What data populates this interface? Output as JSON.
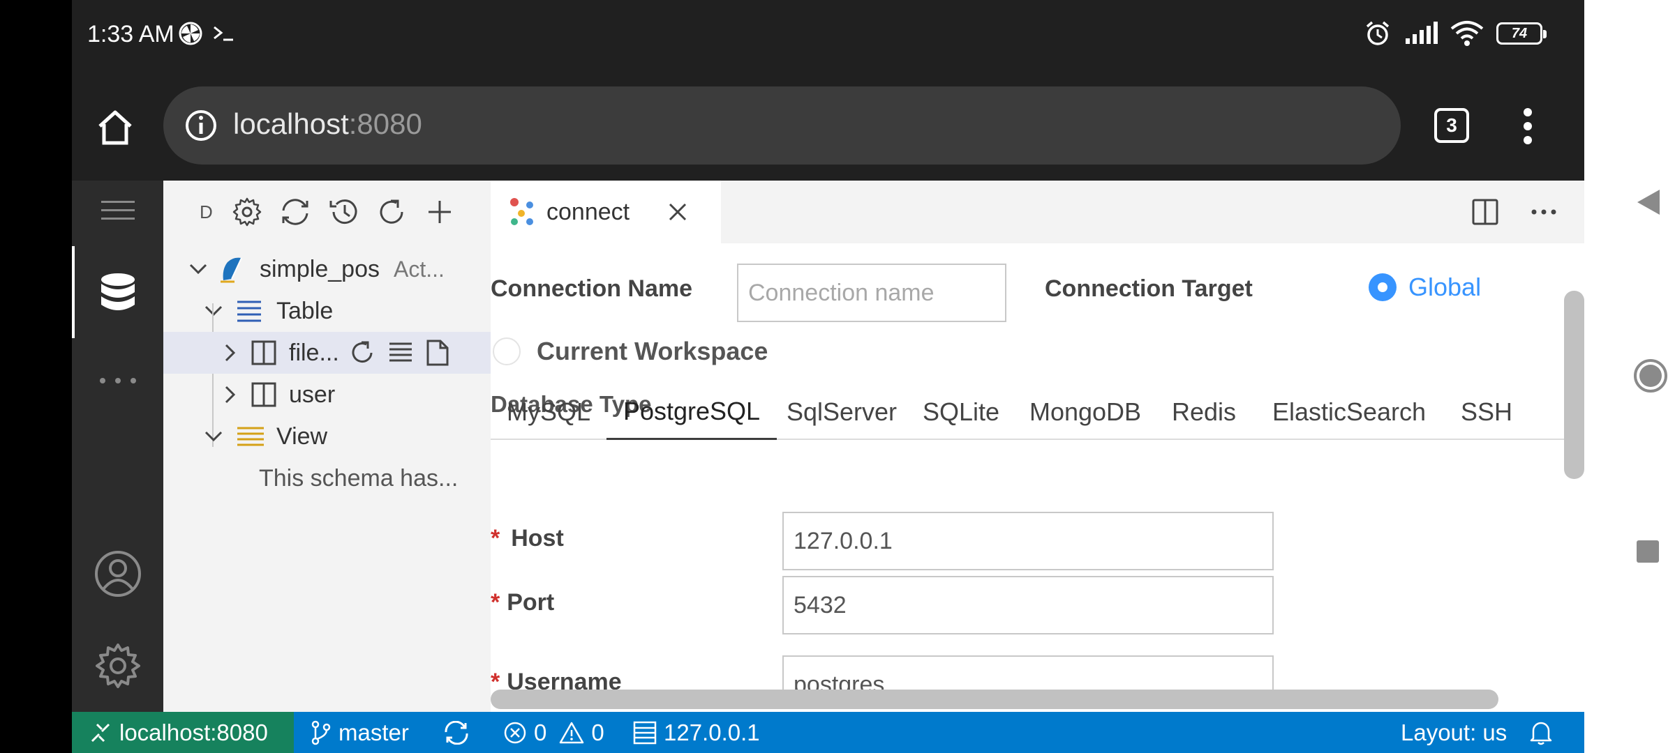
{
  "status_bar": {
    "time": "1:33 AM",
    "battery": "74",
    "icons": [
      "pinwheel-icon",
      "terminal-icon",
      "alarm-icon",
      "signal-icon",
      "wifi-icon",
      "battery-icon"
    ]
  },
  "browser": {
    "url_host": "localhost",
    "url_port": ":8080",
    "tab_count": "3"
  },
  "activity_bar": {
    "items": [
      "menu-icon",
      "database-icon",
      "more-icon",
      "account-icon",
      "settings-icon"
    ],
    "active": "database-icon"
  },
  "sidebar": {
    "toolbar_label": "D",
    "tree": {
      "connection": "simple_pos",
      "connection_status": "Act...",
      "table_group": "Table",
      "tables": [
        "file...",
        "user"
      ],
      "view_group": "View",
      "view_empty": "This schema has..."
    }
  },
  "editor": {
    "tab_label": "connect",
    "form": {
      "connection_name_label": "Connection Name",
      "connection_name_placeholder": "Connection name",
      "connection_name_value": "",
      "connection_target_label": "Connection Target",
      "target_global": "Global",
      "target_workspace": "Current Workspace",
      "target_selected": "Global",
      "database_type_label": "Database Type",
      "db_types": [
        "MySQL",
        "PostgreSQL",
        "SqlServer",
        "SQLite",
        "MongoDB",
        "Redis",
        "ElasticSearch",
        "SSH"
      ],
      "db_type_selected": "PostgreSQL",
      "required_mark": "*",
      "host_label": "Host",
      "host_value": "127.0.0.1",
      "port_label": "Port",
      "port_value": "5432",
      "username_label": "Username",
      "username_value": "postgres"
    }
  },
  "vscode_status": {
    "remote": "localhost:8080",
    "branch": "master",
    "errors": "0",
    "warnings": "0",
    "server": "127.0.0.1",
    "layout": "Layout: us"
  },
  "colors": {
    "accent": "#3794ff",
    "statusbar_blue": "#007acc",
    "remote_green": "#16825d",
    "required_red": "#d0312d"
  }
}
